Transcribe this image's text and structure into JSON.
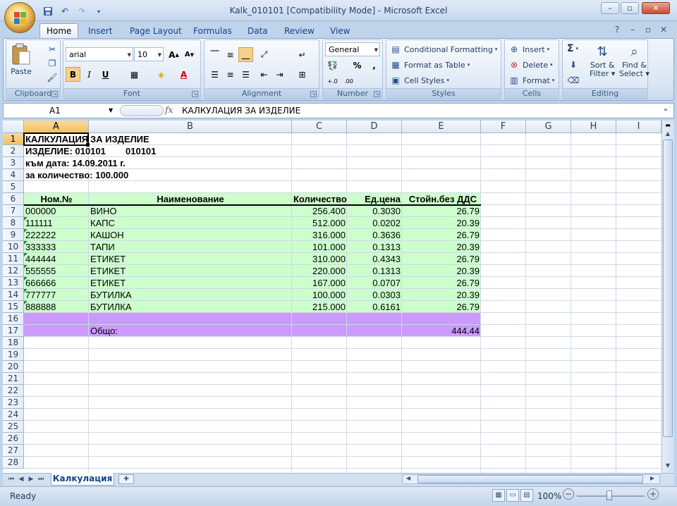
{
  "window": {
    "title": "Kalk_010101  [Compatibility Mode] - Microsoft Excel",
    "icons": {
      "office": "office-logo-icon",
      "save": "save-icon",
      "undo": "undo-icon",
      "redo": "redo-icon",
      "customize": "dropdown-icon"
    }
  },
  "tabs": [
    "Home",
    "Insert",
    "Page Layout",
    "Formulas",
    "Data",
    "Review",
    "View"
  ],
  "active_tab": "Home",
  "ribbon": {
    "clipboard": {
      "label": "Clipboard",
      "paste": "Paste"
    },
    "font": {
      "label": "Font",
      "name": "arial",
      "size": "10",
      "bold": "B",
      "italic": "I",
      "underline": "U",
      "grow": "A",
      "shrink": "A",
      "font_color": "A"
    },
    "alignment": {
      "label": "Alignment"
    },
    "number": {
      "label": "Number",
      "format": "General",
      "percent": "%",
      "comma": ","
    },
    "styles": {
      "label": "Styles",
      "conditional": "Conditional Formatting",
      "table": "Format as Table",
      "cell_styles": "Cell Styles"
    },
    "cells": {
      "label": "Cells",
      "insert": "Insert",
      "delete": "Delete",
      "format": "Format"
    },
    "editing": {
      "label": "Editing",
      "sum": "Σ",
      "sort_line1": "Sort &",
      "sort_line2": "Filter",
      "find_line1": "Find &",
      "find_line2": "Select"
    }
  },
  "formula_bar": {
    "name_box": "A1",
    "fx": "fx",
    "content": "КАЛКУЛАЦИЯ ЗА ИЗДЕЛИЕ"
  },
  "columns": [
    "A",
    "B",
    "C",
    "D",
    "E",
    "F",
    "G",
    "H",
    "I"
  ],
  "rows": [
    "1",
    "2",
    "3",
    "4",
    "5",
    "6",
    "7",
    "8",
    "9",
    "10",
    "11",
    "12",
    "13",
    "14",
    "15",
    "16",
    "17",
    "18",
    "19",
    "20",
    "21",
    "22",
    "23",
    "24",
    "25",
    "26",
    "27",
    "28"
  ],
  "sheet": {
    "header_lines": {
      "r1_a": "КАЛКУЛАЦИЯ",
      "r1_b": "ЗА ИЗДЕЛИЕ",
      "r2": "ИЗДЕЛИЕ: 010101",
      "r2_code": "010101",
      "r3": "към дата: 14.09.2011 г.",
      "r4": "за количество: 100.000"
    },
    "table_headers": [
      "Ном.№",
      "Наименование",
      "Количество",
      "Ед.цена",
      "Стойн.без ДДС"
    ],
    "table_rows": [
      [
        "000000",
        "ВИНО",
        "256.400",
        "0.3030",
        "26.79"
      ],
      [
        "111111",
        "КАПС",
        "512.000",
        "0.0202",
        "20.39"
      ],
      [
        "222222",
        "КАШОН",
        "316.000",
        "0.3636",
        "26.79"
      ],
      [
        "333333",
        "ТАПИ",
        "101.000",
        "0.1313",
        "20.39"
      ],
      [
        "444444",
        "ЕТИКЕТ",
        "310.000",
        "0.4343",
        "26.79"
      ],
      [
        "555555",
        "ЕТИКЕТ",
        "220.000",
        "0.1313",
        "20.39"
      ],
      [
        "666666",
        "ЕТИКЕТ",
        "167.000",
        "0.0707",
        "26.79"
      ],
      [
        "777777",
        "БУТИЛКА",
        "100.000",
        "0.0303",
        "20.39"
      ],
      [
        "888888",
        "БУТИЛКА",
        "215.000",
        "0.6161",
        "26.79"
      ]
    ],
    "total_label": "Общо:",
    "total_value": "444.44",
    "colors": {
      "table_fill": "#ccffcc",
      "total_fill": "#cc99ff",
      "selection": "#f1c15f"
    }
  },
  "sheet_tabs": [
    "Калкулация"
  ],
  "status": {
    "ready": "Ready",
    "zoom": "100%"
  }
}
